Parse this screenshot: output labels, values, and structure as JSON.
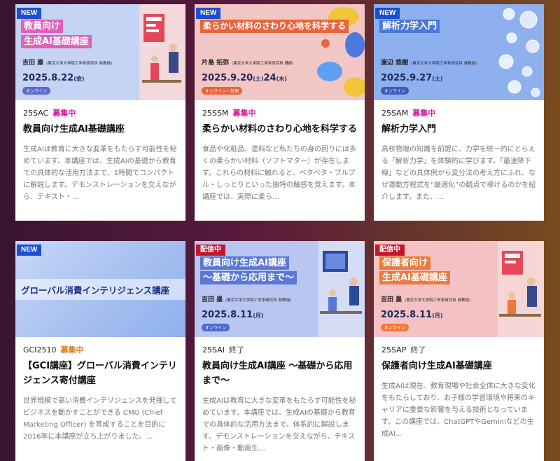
{
  "cards": [
    {
      "badge": "NEW",
      "thumb_title_lines": [
        "教員向け",
        "生成AI基礎講座"
      ],
      "thumb_name": "吉田 塁",
      "thumb_affil": "(東京大学大学院工学系研究科 准教授)",
      "thumb_date": "2025.8.22",
      "thumb_day": "(金)",
      "thumb_mode": "オンライン",
      "code": "25SAC",
      "status": "募集中",
      "title": "教員向け生成AI基礎講座",
      "desc": "生成AIは教育に大きな変革をもたらす可能性を秘めています。本講座では、生成AIの基礎から教育での具体的な活用方法まで、1時間でコンパクトに解説します。デモンストレーションを交えながら、テキスト・…",
      "colors": {
        "thumb_bg": "#c5d3f5",
        "title_bg": "#e060b8"
      }
    },
    {
      "badge": "NEW",
      "thumb_title_lines": [
        "柔らかい材料のさわり心地を科学する"
      ],
      "thumb_name": "片島 拓弥",
      "thumb_affil": "(東京大学大学院工学系研究科 講師)",
      "thumb_date": "2025.9.20",
      "thumb_day": "(土)",
      "thumb_date2": "24",
      "thumb_day2": "(水)",
      "thumb_mode": "オンライン・対面",
      "code": "25SSM",
      "status": "募集中",
      "title": "柔らかい材料のさわり心地を科学する",
      "desc": "食品や化粧品、塗料など私たちの身の回りには多くの柔らかい材料（ソフトマター）が存在します。これらの材料に触れると、ベタベタ・プルプル・しっとりといった独特の触感を覚えます。本講座では、実際に柔ら…",
      "colors": {
        "thumb_bg": "#f3c6c6",
        "title_bg": "#e8643a"
      }
    },
    {
      "badge": "NEW",
      "thumb_title_lines": [
        "解析力学入門"
      ],
      "thumb_name": "渡辺 悠樹",
      "thumb_affil": "(東京大学大学院工学系研究科 准教授)",
      "thumb_date": "2025.9.27",
      "thumb_day": "(土)",
      "thumb_mode": "オンライン",
      "code": "25SAM",
      "status": "募集中",
      "title": "解析力学入門",
      "desc": "高校物理の知識を前提に、力学を統一的にとらえる「解析力学」を体験的に学びます。「最速降下線」などの具体例から変分法の考え方にふれ、なぜ運動方程式を“最適化”の観点で導けるのかを紹介します。また、…",
      "colors": {
        "thumb_bg": "#8fb0ee",
        "title_bg": "#4a78d8"
      }
    },
    {
      "badge": "NEW",
      "thumb_title_lines": [
        "グローバル消費インテリジェンス講座"
      ],
      "code": "GCI2510",
      "status": "募集中",
      "title": "【GCI講座】グローバル消費インテリジェンス寄付講座",
      "desc": "世界規模で高い消費インテリジェンスを発揮してビジネスを動かすことができる CMO (Chief Marketing Officer) を育成することを目的に2016年に本講座が立ち上がりました。…",
      "colors": {
        "thumb_bg": "#a9c2f0",
        "title_bg": "#1c2f8a"
      }
    },
    {
      "badge": "配信中",
      "thumb_title_lines": [
        "教員向け生成AI講座",
        "～基礎から応用まで～"
      ],
      "thumb_name": "吉田 塁",
      "thumb_affil": "(東京大学大学院工学系研究科 准教授)",
      "thumb_date": "2025.8.11",
      "thumb_day": "(月)",
      "thumb_mode": "オンライン",
      "code": "25SAI",
      "status": "終了",
      "title": "教員向け生成AI講座 ～基礎から応用まで～",
      "desc": "生成AIは教育に大きな変革をもたらす可能性を秘めています。本講座では、生成AIの基礎から教育での具体的な活用方法まで、体系的に解説します。デモンストレーションを交えながら、テキスト・画像・動画生…",
      "colors": {
        "thumb_bg": "#b9c6f2",
        "title_bg": "#5a78d6"
      }
    },
    {
      "badge": "配信中",
      "thumb_title_lines": [
        "保護者向け",
        "生成AI基礎講座"
      ],
      "thumb_name": "吉田 塁",
      "thumb_affil": "(東京大学大学院工学系研究科 准教授)",
      "thumb_date": "2025.8.11",
      "thumb_day": "(月)",
      "thumb_mode": "オンライン",
      "code": "25SAP",
      "status": "終了",
      "title": "保護者向け生成AI基礎講座",
      "desc": "生成AIは現在、教育現場や社会全体に大きな変化をもたらしており、お子様の学習環境や将来のキャリアに重要な影響を与える技術となっています。この講座では、ChatGPTやGeminiなどの生成AI…",
      "colors": {
        "thumb_bg": "#f4c2c4",
        "title_bg": "#f07838"
      }
    }
  ]
}
